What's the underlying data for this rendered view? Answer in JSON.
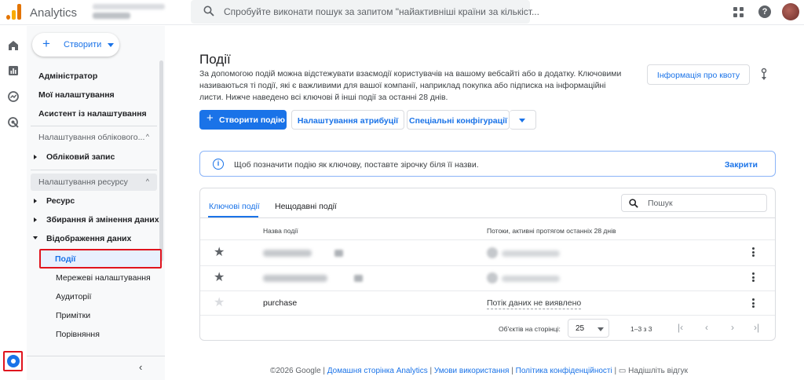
{
  "app": {
    "name": "Analytics"
  },
  "search": {
    "placeholder": "Спробуйте виконати пошук за запитом \"найактивніші країни за кількіст..."
  },
  "colors": {
    "accent": "#1a73e8",
    "highlight": "#e0141e",
    "logo_orange": "#e37400",
    "logo_yellow": "#f9ab00"
  },
  "rail": {
    "icons": [
      "home-icon",
      "reports-icon",
      "explore-icon",
      "advertising-icon",
      "admin-settings-icon"
    ]
  },
  "sidebar": {
    "create_label": "Створити",
    "top_items": [
      "Адміністратор",
      "Мої налаштування",
      "Асистент із налаштування"
    ],
    "account_section": "Налаштування облікового...",
    "account_item": "Обліковий запис",
    "property_section": "Налаштування ресурсу",
    "property_items": [
      "Ресурс",
      "Збирання й змінення даних",
      "Відображення даних"
    ],
    "display_subitems": [
      "Події",
      "Мережеві налаштування",
      "Аудиторії",
      "Примітки",
      "Порівняння"
    ],
    "collapse_icon": "chevron-left-icon"
  },
  "main": {
    "title": "Події",
    "description": "За допомогою подій можна відстежувати взаємодії користувачів на вашому вебсайті або в додатку. Ключовими називаються ті події, які є важливими для вашої компанії, наприклад покупка або підписка на інформаційні листи. Нижче наведено всі ключові й інші події за останні 28 днів.",
    "quota_button": "Інформація про квоту",
    "create_event_button": "Створити подію",
    "attribution_button": "Налаштування атрибуції",
    "special_configs_button": "Спеціальні конфігурації",
    "info_text": "Щоб позначити подію як ключову, поставте зірочку біля її назви.",
    "info_close": "Закрити",
    "tabs": [
      "Ключові події",
      "Нещодавні події"
    ],
    "table_search_placeholder": "Пошук",
    "columns": [
      "Назва події",
      "Потоки, активні протягом останніх 28 днів"
    ],
    "rows": [
      {
        "starred": true,
        "name_blurred": true,
        "stream_blurred": true
      },
      {
        "starred": true,
        "name_blurred": true,
        "stream_blurred": true
      },
      {
        "starred": false,
        "name": "purchase",
        "stream": "Потік даних не виявлено"
      }
    ],
    "pager": {
      "label": "Об'єктів на сторінці:",
      "page_size": "25",
      "range": "1–3 з 3"
    }
  },
  "footer": {
    "copyright": "©2026 Google |",
    "links": [
      "Домашня сторінка Analytics",
      "Умови використання",
      "Політика конфіденційності"
    ],
    "feedback": "Надішліть відгук"
  }
}
